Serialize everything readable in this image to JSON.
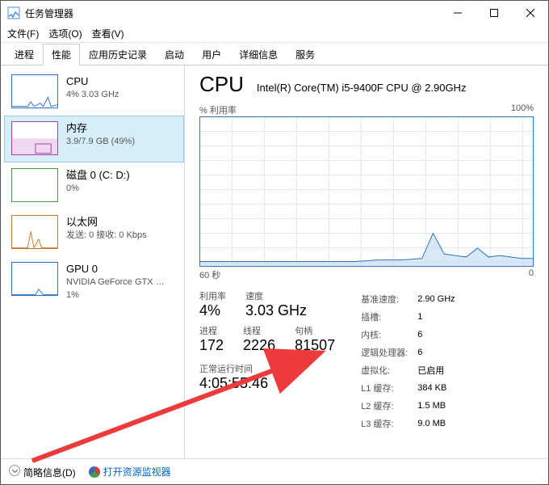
{
  "window": {
    "title": "任务管理器"
  },
  "menu": {
    "file": "文件(F)",
    "options": "选项(O)",
    "view": "查看(V)"
  },
  "tabs": [
    "进程",
    "性能",
    "应用历史记录",
    "启动",
    "用户",
    "详细信息",
    "服务"
  ],
  "active_tab": 1,
  "sidebar": {
    "items": [
      {
        "name": "CPU",
        "val": "4% 3.03 GHz",
        "kind": "cpu"
      },
      {
        "name": "内存",
        "val": "3.9/7.9 GB (49%)",
        "kind": "mem"
      },
      {
        "name": "磁盘 0 (C: D:)",
        "val": "0%",
        "kind": "disk"
      },
      {
        "name": "以太网",
        "val": "发送: 0 接收: 0 Kbps",
        "kind": "eth"
      },
      {
        "name": "GPU 0",
        "val": "NVIDIA GeForce GTX …\n1%",
        "kind": "gpu"
      }
    ],
    "selected": 1
  },
  "main": {
    "title": "CPU",
    "model": "Intel(R) Core(TM) i5-9400F CPU @ 2.90GHz",
    "y_label": "% 利用率",
    "y_max": "100%",
    "x_left": "60 秒",
    "x_right": "0"
  },
  "stats": {
    "util_lbl": "利用率",
    "util_val": "4%",
    "speed_lbl": "速度",
    "speed_val": "3.03 GHz",
    "proc_lbl": "进程",
    "proc_val": "172",
    "thread_lbl": "线程",
    "thread_val": "2226",
    "handle_lbl": "句柄",
    "handle_val": "81507",
    "uptime_lbl": "正常运行时间",
    "uptime_val": "4:05:55:46"
  },
  "specs": [
    {
      "k": "基准速度:",
      "v": "2.90 GHz"
    },
    {
      "k": "插槽:",
      "v": "1"
    },
    {
      "k": "内核:",
      "v": "6"
    },
    {
      "k": "逻辑处理器:",
      "v": "6"
    },
    {
      "k": "虚拟化:",
      "v": "已启用"
    },
    {
      "k": "L1 缓存:",
      "v": "384 KB"
    },
    {
      "k": "L2 缓存:",
      "v": "1.5 MB"
    },
    {
      "k": "L3 缓存:",
      "v": "9.0 MB"
    }
  ],
  "footer": {
    "brief": "简略信息(D)",
    "resmon": "打开资源监视器"
  },
  "chart_data": {
    "type": "line",
    "title": "% 利用率",
    "xlabel": "秒",
    "ylabel": "%",
    "ylim": [
      0,
      100
    ],
    "xlim": [
      60,
      0
    ],
    "x": [
      60,
      56,
      52,
      48,
      44,
      40,
      36,
      32,
      28,
      24,
      20,
      18,
      16,
      14,
      12,
      10,
      8,
      6,
      4,
      2,
      0
    ],
    "values": [
      3,
      3,
      3,
      3,
      3,
      3,
      3,
      3,
      4,
      4,
      5,
      22,
      8,
      7,
      6,
      12,
      6,
      7,
      6,
      5,
      5
    ]
  }
}
